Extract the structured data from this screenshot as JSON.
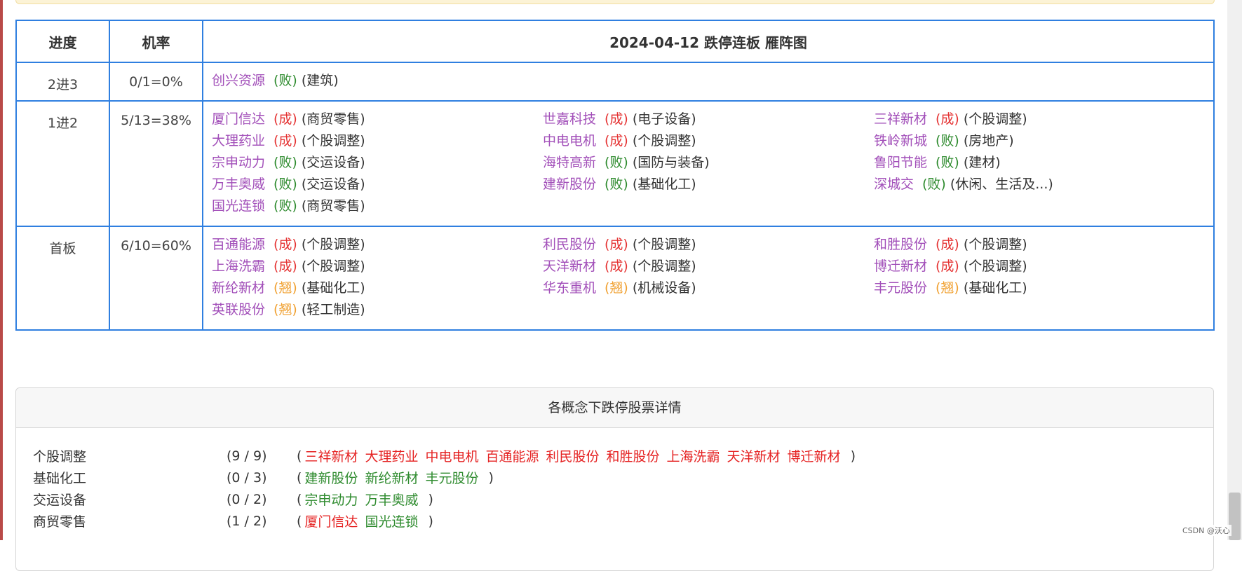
{
  "ladder": {
    "headers": {
      "stage": "进度",
      "rate": "机率",
      "title": "2024-04-12 跌停连板 雁阵图"
    },
    "rows": [
      {
        "stage": "2进3",
        "rate": "0/1=0%",
        "items": [
          {
            "name": "创兴资源",
            "result": "(败)",
            "kind": "fail",
            "industry": "(建筑)"
          }
        ]
      },
      {
        "stage": "1进2",
        "rate": "5/13=38%",
        "items": [
          {
            "name": "厦门信达",
            "result": "(成)",
            "kind": "succeed",
            "industry": "(商贸零售)"
          },
          {
            "name": "世嘉科技",
            "result": "(成)",
            "kind": "succeed",
            "industry": "(电子设备)"
          },
          {
            "name": "三祥新材",
            "result": "(成)",
            "kind": "succeed",
            "industry": "(个股调整)"
          },
          {
            "name": "大理药业",
            "result": "(成)",
            "kind": "succeed",
            "industry": "(个股调整)"
          },
          {
            "name": "中电电机",
            "result": "(成)",
            "kind": "succeed",
            "industry": "(个股调整)"
          },
          {
            "name": "铁岭新城",
            "result": "(败)",
            "kind": "fail",
            "industry": "(房地产)"
          },
          {
            "name": "宗申动力",
            "result": "(败)",
            "kind": "fail",
            "industry": "(交运设备)"
          },
          {
            "name": "海特高新",
            "result": "(败)",
            "kind": "fail",
            "industry": "(国防与装备)"
          },
          {
            "name": "鲁阳节能",
            "result": "(败)",
            "kind": "fail",
            "industry": "(建材)"
          },
          {
            "name": "万丰奥威",
            "result": "(败)",
            "kind": "fail",
            "industry": "(交运设备)"
          },
          {
            "name": "建新股份",
            "result": "(败)",
            "kind": "fail",
            "industry": "(基础化工)"
          },
          {
            "name": "深城交",
            "result": "(败)",
            "kind": "fail",
            "industry": "(休闲、生活及...)"
          },
          {
            "name": "国光连锁",
            "result": "(败)",
            "kind": "fail",
            "industry": "(商贸零售)"
          }
        ]
      },
      {
        "stage": "首板",
        "rate": "6/10=60%",
        "items": [
          {
            "name": "百通能源",
            "result": "(成)",
            "kind": "succeed",
            "industry": "(个股调整)"
          },
          {
            "name": "利民股份",
            "result": "(成)",
            "kind": "succeed",
            "industry": "(个股调整)"
          },
          {
            "name": "和胜股份",
            "result": "(成)",
            "kind": "succeed",
            "industry": "(个股调整)"
          },
          {
            "name": "上海洗霸",
            "result": "(成)",
            "kind": "succeed",
            "industry": "(个股调整)"
          },
          {
            "name": "天洋新材",
            "result": "(成)",
            "kind": "succeed",
            "industry": "(个股调整)"
          },
          {
            "name": "博迁新材",
            "result": "(成)",
            "kind": "succeed",
            "industry": "(个股调整)"
          },
          {
            "name": "新纶新材",
            "result": "(翘)",
            "kind": "bend",
            "industry": "(基础化工)"
          },
          {
            "name": "华东重机",
            "result": "(翘)",
            "kind": "bend",
            "industry": "(机械设备)"
          },
          {
            "name": "丰元股份",
            "result": "(翘)",
            "kind": "bend",
            "industry": "(基础化工)"
          },
          {
            "name": "英联股份",
            "result": "(翘)",
            "kind": "bend",
            "industry": "(轻工制造)"
          }
        ]
      }
    ]
  },
  "concepts": {
    "title": "各概念下跌停股票详情",
    "open_paren": "(",
    "close_paren": ")",
    "rows": [
      {
        "name": "个股调整",
        "count": "(9 / 9)",
        "stocks": [
          {
            "name": "三祥新材",
            "color": "red"
          },
          {
            "name": "大理药业",
            "color": "red"
          },
          {
            "name": "中电电机",
            "color": "red"
          },
          {
            "name": "百通能源",
            "color": "red"
          },
          {
            "name": "利民股份",
            "color": "red"
          },
          {
            "name": "和胜股份",
            "color": "red"
          },
          {
            "name": "上海洗霸",
            "color": "red"
          },
          {
            "name": "天洋新材",
            "color": "red"
          },
          {
            "name": "博迁新材",
            "color": "red"
          }
        ]
      },
      {
        "name": "基础化工",
        "count": "(0 / 3)",
        "stocks": [
          {
            "name": "建新股份",
            "color": "green"
          },
          {
            "name": "新纶新材",
            "color": "green"
          },
          {
            "name": "丰元股份",
            "color": "green"
          }
        ]
      },
      {
        "name": "交运设备",
        "count": "(0 / 2)",
        "stocks": [
          {
            "name": "宗申动力",
            "color": "green"
          },
          {
            "name": "万丰奥威",
            "color": "green"
          }
        ]
      },
      {
        "name": "商贸零售",
        "count": "(1 / 2)",
        "stocks": [
          {
            "name": "厦门信达",
            "color": "red"
          },
          {
            "name": "国光连锁",
            "color": "green"
          }
        ]
      }
    ]
  },
  "colors": {
    "stock_name": "#a24fb9",
    "succeed": "#e53333",
    "fail": "#2e8b2e",
    "bend": "#f0a030",
    "table_border": "#2f7fe0"
  },
  "watermark": "CSDN @沃心"
}
